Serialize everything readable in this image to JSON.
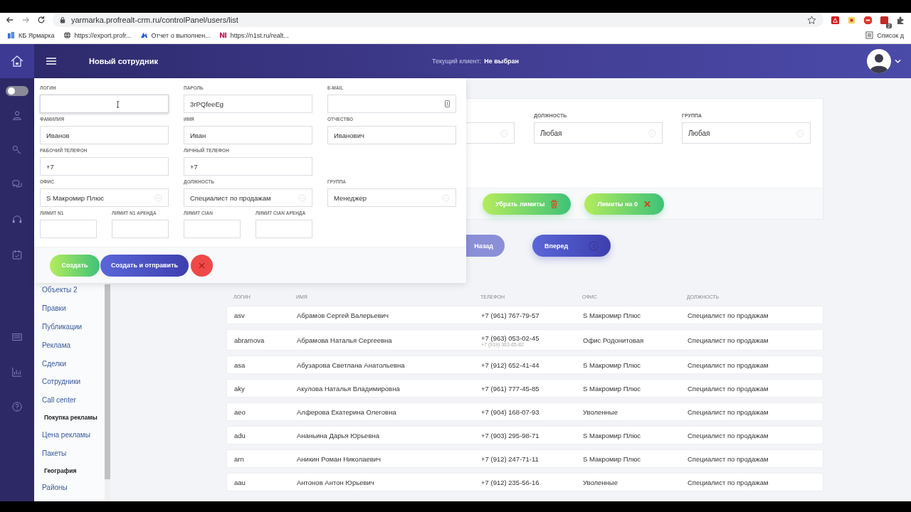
{
  "browser": {
    "url": "yarmarka.profrealt-crm.ru/controlPanel/users/list",
    "extension_badge": "2",
    "bookmarks": [
      {
        "label": "КБ Ярмарка",
        "kind": "building"
      },
      {
        "label": "https://export.profr...",
        "kind": "globe"
      },
      {
        "label": "Отчет о выполнен...",
        "kind": "mark"
      },
      {
        "label": "https://n1st.ru/realt...",
        "kind": "n1"
      }
    ],
    "reading_list": "Список д"
  },
  "header": {
    "title": "Новый сотрудник",
    "client_label": "Текущий клиент:",
    "client_value": "Не выбран"
  },
  "rail": {
    "toggle_on": false
  },
  "sidebar": {
    "items": [
      {
        "label": "Объекты 2",
        "kind": "link"
      },
      {
        "label": "Правки",
        "kind": "link"
      },
      {
        "label": "Публикации",
        "kind": "link"
      },
      {
        "label": "Реклама",
        "kind": "link"
      },
      {
        "label": "Сделки",
        "kind": "link"
      },
      {
        "label": "Сотрудники",
        "kind": "link"
      },
      {
        "label": "Call center",
        "kind": "link"
      },
      {
        "label": "Покупка рекламы",
        "kind": "heading"
      },
      {
        "label": "Цена рекламы",
        "kind": "link"
      },
      {
        "label": "Пакеты",
        "kind": "link"
      },
      {
        "label": "География",
        "kind": "heading"
      },
      {
        "label": "Районы",
        "kind": "link"
      }
    ]
  },
  "filters": {
    "fields": [
      {
        "kind": "select"
      },
      {
        "kind": "select",
        "label": "ДОЛЖНОСТЬ",
        "value": "Любая"
      },
      {
        "kind": "select",
        "label": "ГРУППА",
        "value": "Любая"
      }
    ],
    "actions": [
      {
        "label": "Убрать лимиты",
        "kind": "clear"
      },
      {
        "label": "Лимиты на 0",
        "kind": "zero"
      }
    ]
  },
  "pagination": {
    "prev": "Назад",
    "next": "Вперед"
  },
  "table": {
    "columns": [
      "ЛОГИН",
      "ИМЯ",
      "ТЕЛЕФОН",
      "ОФИС",
      "ДОЛЖНОСТЬ"
    ],
    "rows": [
      {
        "login": "asv",
        "name": "Абрамов Сергей Валерьевич",
        "phone": "+7 (961) 767-79-57",
        "office": "S Макромир Плюс",
        "position": "Специалист по продажам"
      },
      {
        "login": "abramova",
        "name": "Абрамова Наталья Сергеевна",
        "phone": "+7 (963) 053-02-45",
        "phone_2": "+7 (919) 363-65-82",
        "office": "Офис Родонитовая",
        "position": "Специалист по продажам"
      },
      {
        "login": "asa",
        "name": "Абузарова Светлана Анатольевна",
        "phone": "+7 (912) 652-41-44",
        "office": "S Макромир Плюс",
        "position": "Специалист по продажам"
      },
      {
        "login": "aky",
        "name": "Акулова Наталья Владимировна",
        "phone": "+7 (961) 777-45-85",
        "office": "S Макромир Плюс",
        "position": "Специалист по продажам"
      },
      {
        "login": "aeo",
        "name": "Алферова Екатерина Олеговна",
        "phone": "+7 (904) 168-07-93",
        "office": "Уволенные",
        "position": "Специалист по продажам"
      },
      {
        "login": "adu",
        "name": "Ананьина Дарья Юрьевна",
        "phone": "+7 (903) 295-98-71",
        "office": "S Макромир Плюс",
        "position": "Специалист по продажам"
      },
      {
        "login": "arn",
        "name": "Аникин Роман Николаевич",
        "phone": "+7 (912) 247-71-11",
        "office": "S Макромир Плюс",
        "position": "Специалист по продажам"
      },
      {
        "login": "aau",
        "name": "Антонов Антон Юрьевич",
        "phone": "+7 (912) 235-56-16",
        "office": "Уволенные",
        "position": "Специалист по продажам"
      }
    ]
  },
  "dialog": {
    "rows": [
      {
        "kind": "wide",
        "fields": [
          {
            "label": "ЛОГИН",
            "kind": "text",
            "focused": true
          },
          {
            "label": "ПАРОЛЬ",
            "kind": "text",
            "value": "3rPQfeeEg"
          },
          {
            "label": "E-MAIL",
            "kind": "email"
          }
        ]
      },
      {
        "kind": "wide",
        "fields": [
          {
            "label": "ФАМИЛИЯ",
            "kind": "text",
            "value": "Иванов"
          },
          {
            "label": "ИМЯ",
            "kind": "text",
            "value": "Иван"
          },
          {
            "label": "ОТЧЕСТВО",
            "kind": "text",
            "value": "Иванович"
          }
        ]
      },
      {
        "kind": "wide",
        "fields": [
          {
            "label": "РАБОЧИЙ ТЕЛЕФОН",
            "kind": "text",
            "value": "+7"
          },
          {
            "label": "ЛИЧНЫЙ ТЕЛЕФОН",
            "kind": "text",
            "value": "+7"
          }
        ]
      },
      {
        "kind": "wide",
        "fields": [
          {
            "label": "ОФИС",
            "kind": "select",
            "value": "S Макромир Плюс"
          },
          {
            "label": "ДОЛЖНОСТЬ",
            "kind": "select",
            "value": "Специалист по продажам"
          },
          {
            "label": "ГРУППА",
            "kind": "select",
            "value": "Менеджер"
          }
        ]
      },
      {
        "kind": "narrow",
        "fields": [
          {
            "label": "ЛИМИТ N1",
            "kind": "text"
          },
          {
            "label": "ЛИМИТ N1 АРЕНДА",
            "kind": "text"
          },
          {
            "label": "ЛИМИТ CIAN",
            "kind": "text"
          },
          {
            "label": "ЛИМИТ CIAN АРЕНДА",
            "kind": "text"
          }
        ]
      }
    ],
    "buttons": [
      {
        "label": "Создать",
        "kind": "create"
      },
      {
        "label": "Создать и отправить",
        "kind": "send"
      },
      {
        "kind": "close"
      }
    ]
  }
}
